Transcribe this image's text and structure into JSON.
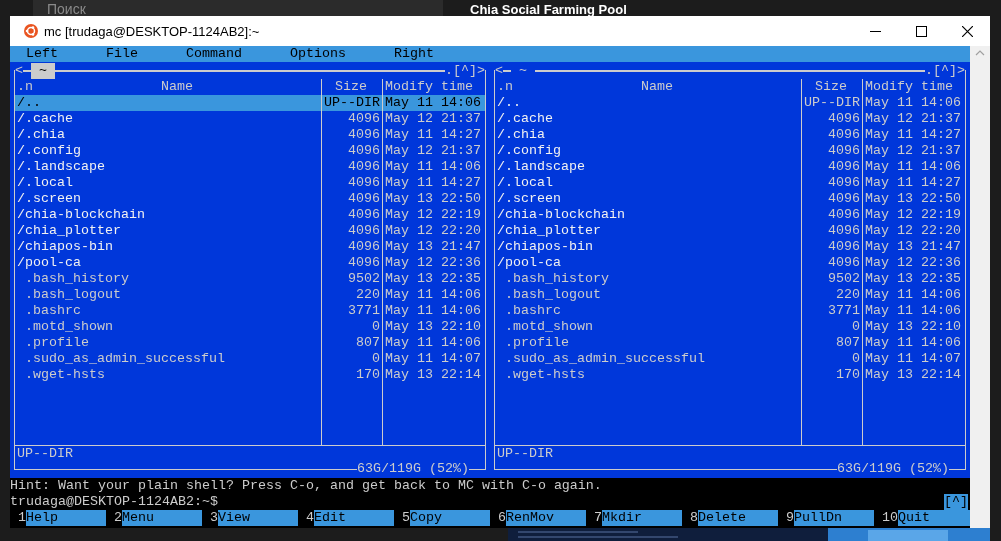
{
  "background": {
    "search_label": "Поиск",
    "page_title": "Chia Social Farming Pool"
  },
  "window": {
    "title": "mc [trudaga@DESKTOP-1124AB2]:~"
  },
  "menu": [
    {
      "label": "Left"
    },
    {
      "label": "File"
    },
    {
      "label": "Command"
    },
    {
      "label": "Options"
    },
    {
      "label": "Right"
    }
  ],
  "panels": [
    {
      "active": true,
      "back_marker": "<",
      "path": "~",
      "corner_marker": ".[^]>",
      "columns": [
        ".n",
        "Name",
        "Size",
        "Modify time"
      ],
      "rows": [
        {
          "kind": "updir",
          "name": "/..",
          "size": "UP--DIR",
          "time": "May 11 14:06",
          "selected": true
        },
        {
          "kind": "dir",
          "name": "/.cache",
          "size": "4096",
          "time": "May 12 21:37",
          "selected": false
        },
        {
          "kind": "dir",
          "name": "/.chia",
          "size": "4096",
          "time": "May 11 14:27",
          "selected": false
        },
        {
          "kind": "dir",
          "name": "/.config",
          "size": "4096",
          "time": "May 12 21:37",
          "selected": false
        },
        {
          "kind": "dir",
          "name": "/.landscape",
          "size": "4096",
          "time": "May 11 14:06",
          "selected": false
        },
        {
          "kind": "dir",
          "name": "/.local",
          "size": "4096",
          "time": "May 11 14:27",
          "selected": false
        },
        {
          "kind": "dir",
          "name": "/.screen",
          "size": "4096",
          "time": "May 13 22:50",
          "selected": false
        },
        {
          "kind": "dir",
          "name": "/chia-blockchain",
          "size": "4096",
          "time": "May 12 22:19",
          "selected": false
        },
        {
          "kind": "dir",
          "name": "/chia_plotter",
          "size": "4096",
          "time": "May 12 22:20",
          "selected": false
        },
        {
          "kind": "dir",
          "name": "/chiapos-bin",
          "size": "4096",
          "time": "May 13 21:47",
          "selected": false
        },
        {
          "kind": "dir",
          "name": "/pool-ca",
          "size": "4096",
          "time": "May 12 22:36",
          "selected": false
        },
        {
          "kind": "file",
          "name": ".bash_history",
          "size": "9502",
          "time": "May 13 22:35",
          "selected": false
        },
        {
          "kind": "file",
          "name": ".bash_logout",
          "size": "220",
          "time": "May 11 14:06",
          "selected": false
        },
        {
          "kind": "file",
          "name": ".bashrc",
          "size": "3771",
          "time": "May 11 14:06",
          "selected": false
        },
        {
          "kind": "file",
          "name": ".motd_shown",
          "size": "0",
          "time": "May 13 22:10",
          "selected": false
        },
        {
          "kind": "file",
          "name": ".profile",
          "size": "807",
          "time": "May 11 14:06",
          "selected": false
        },
        {
          "kind": "file",
          "name": ".sudo_as_admin_successful",
          "size": "0",
          "time": "May 11 14:07",
          "selected": false
        },
        {
          "kind": "file",
          "name": ".wget-hsts",
          "size": "170",
          "time": "May 13 22:14",
          "selected": false
        }
      ],
      "status": "UP--DIR",
      "disk": "63G/119G (52%)"
    },
    {
      "active": false,
      "back_marker": "<",
      "path": "~",
      "corner_marker": ".[^]>",
      "columns": [
        ".n",
        "Name",
        "Size",
        "Modify time"
      ],
      "rows": [
        {
          "kind": "updir",
          "name": "/..",
          "size": "UP--DIR",
          "time": "May 11 14:06",
          "selected": false
        },
        {
          "kind": "dir",
          "name": "/.cache",
          "size": "4096",
          "time": "May 12 21:37",
          "selected": false
        },
        {
          "kind": "dir",
          "name": "/.chia",
          "size": "4096",
          "time": "May 11 14:27",
          "selected": false
        },
        {
          "kind": "dir",
          "name": "/.config",
          "size": "4096",
          "time": "May 12 21:37",
          "selected": false
        },
        {
          "kind": "dir",
          "name": "/.landscape",
          "size": "4096",
          "time": "May 11 14:06",
          "selected": false
        },
        {
          "kind": "dir",
          "name": "/.local",
          "size": "4096",
          "time": "May 11 14:27",
          "selected": false
        },
        {
          "kind": "dir",
          "name": "/.screen",
          "size": "4096",
          "time": "May 13 22:50",
          "selected": false
        },
        {
          "kind": "dir",
          "name": "/chia-blockchain",
          "size": "4096",
          "time": "May 12 22:19",
          "selected": false
        },
        {
          "kind": "dir",
          "name": "/chia_plotter",
          "size": "4096",
          "time": "May 12 22:20",
          "selected": false
        },
        {
          "kind": "dir",
          "name": "/chiapos-bin",
          "size": "4096",
          "time": "May 13 21:47",
          "selected": false
        },
        {
          "kind": "dir",
          "name": "/pool-ca",
          "size": "4096",
          "time": "May 12 22:36",
          "selected": false
        },
        {
          "kind": "file",
          "name": ".bash_history",
          "size": "9502",
          "time": "May 13 22:35",
          "selected": false
        },
        {
          "kind": "file",
          "name": ".bash_logout",
          "size": "220",
          "time": "May 11 14:06",
          "selected": false
        },
        {
          "kind": "file",
          "name": ".bashrc",
          "size": "3771",
          "time": "May 11 14:06",
          "selected": false
        },
        {
          "kind": "file",
          "name": ".motd_shown",
          "size": "0",
          "time": "May 13 22:10",
          "selected": false
        },
        {
          "kind": "file",
          "name": ".profile",
          "size": "807",
          "time": "May 11 14:06",
          "selected": false
        },
        {
          "kind": "file",
          "name": ".sudo_as_admin_successful",
          "size": "0",
          "time": "May 11 14:07",
          "selected": false
        },
        {
          "kind": "file",
          "name": ".wget-hsts",
          "size": "170",
          "time": "May 13 22:14",
          "selected": false
        }
      ],
      "status": "UP--DIR",
      "disk": "63G/119G (52%)"
    }
  ],
  "hint": "Hint: Want your plain shell? Press C-o, and get back to MC with C-o again.",
  "prompt": "trudaga@DESKTOP-1124AB2:~$",
  "history_button": "[^]",
  "function_keys": [
    {
      "number": "1",
      "label": "Help"
    },
    {
      "number": "2",
      "label": "Menu"
    },
    {
      "number": "3",
      "label": "View"
    },
    {
      "number": "4",
      "label": "Edit"
    },
    {
      "number": "5",
      "label": "Copy"
    },
    {
      "number": "6",
      "label": "RenMov"
    },
    {
      "number": "7",
      "label": "Mkdir"
    },
    {
      "number": "8",
      "label": "Delete"
    },
    {
      "number": "9",
      "label": "PullDn"
    },
    {
      "number": "10",
      "label": "Quit"
    }
  ]
}
